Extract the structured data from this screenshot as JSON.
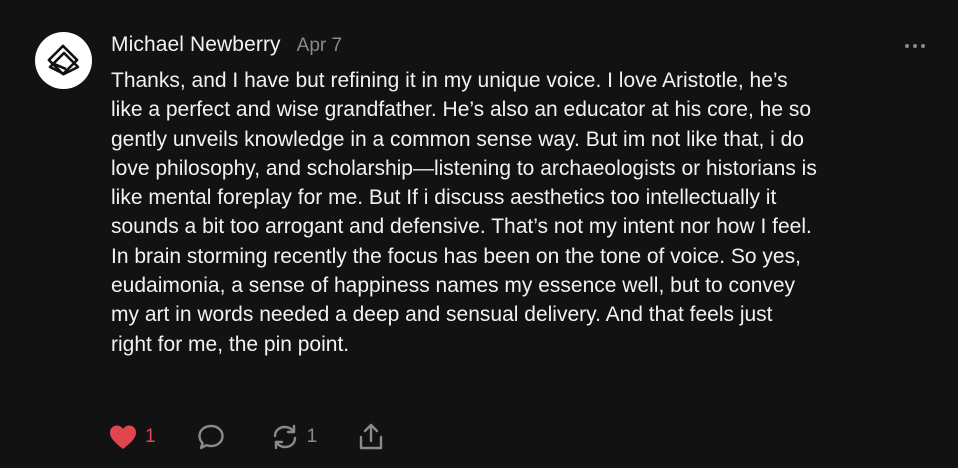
{
  "comment": {
    "author": "Michael Newberry",
    "date": "Apr 7",
    "body_lines": [
      "Thanks, and I have but refining it in my unique voice. I love Aristotle, he’s",
      "like a perfect and wise grandfather. He’s also an educator at his core, he so",
      "gently unveils knowledge in a common sense way. But im not like that, i do",
      "love philosophy, and scholarship—listening to archaeologists or historians is",
      "like mental foreplay for me. But If i discuss aesthetics too intellectually it",
      "sounds a bit too arrogant and defensive. That’s not my intent nor how I feel.",
      "In brain storming recently the focus has been on the tone of voice. So yes,",
      "eudaimonia, a sense of happiness names my essence well, but to convey",
      "my art in words needed a deep and sensual delivery. And that feels just",
      "right for me, the pin point."
    ],
    "actions": {
      "like_count": "1",
      "restack_count": "1"
    }
  },
  "colors": {
    "background": "#121212",
    "text": "#f2f2f2",
    "muted": "#8a8a8a",
    "like": "#e0464d"
  },
  "icons": {
    "avatar": "logo-icon",
    "more": "more-options-icon",
    "like": "heart-icon",
    "reply": "comment-icon",
    "restack": "restack-icon",
    "share": "share-icon"
  }
}
